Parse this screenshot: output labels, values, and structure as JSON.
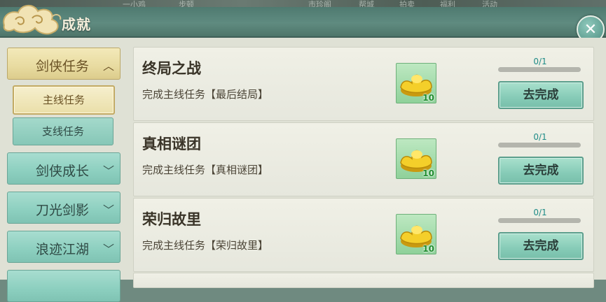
{
  "header": {
    "title": "成就",
    "close_icon": "close-icon"
  },
  "background_labels": [
    "一小鸡",
    "步顿",
    "市珍阁",
    "帮城",
    "拍卖",
    "福利",
    "活动"
  ],
  "sidebar": {
    "categories": [
      {
        "label": "剑侠任务",
        "expanded": true,
        "chevron": "chevron-up-icon"
      },
      {
        "label": "剑侠成长",
        "expanded": false,
        "chevron": "chevron-down-icon"
      },
      {
        "label": "刀光剑影",
        "expanded": false,
        "chevron": "chevron-down-icon"
      },
      {
        "label": "浪迹江湖",
        "expanded": false,
        "chevron": "chevron-down-icon"
      }
    ],
    "subitems": [
      {
        "label": "主线任务",
        "active": true
      },
      {
        "label": "支线任务",
        "active": false
      }
    ]
  },
  "tasks": [
    {
      "title": "终局之战",
      "desc": "完成主线任务【最后结局】",
      "reward_icon": "gold-ingot-icon",
      "reward_count": "10",
      "progress_text": "0/1",
      "progress": 0,
      "button": "去完成"
    },
    {
      "title": "真相谜团",
      "desc": "完成主线任务【真相谜团】",
      "reward_icon": "gold-ingot-icon",
      "reward_count": "10",
      "progress_text": "0/1",
      "progress": 0,
      "button": "去完成"
    },
    {
      "title": "荣归故里",
      "desc": "完成主线任务【荣归故里】",
      "reward_icon": "gold-ingot-icon",
      "reward_count": "10",
      "progress_text": "0/1",
      "progress": 0,
      "button": "去完成"
    }
  ],
  "colors": {
    "header": "#5f8b80",
    "panel": "#dfe1d5",
    "progress_fill": "#4cb6a4",
    "active_tab": "#eadfa9"
  }
}
